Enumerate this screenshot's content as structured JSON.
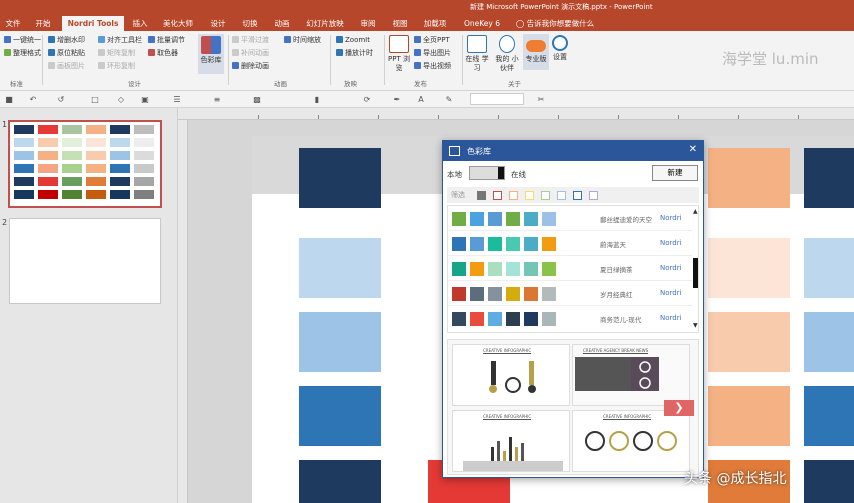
{
  "titlebar": {
    "title": "新建 Microsoft PowerPoint 演示文稿.pptx - PowerPoint"
  },
  "tabs": [
    {
      "label": "文件"
    },
    {
      "label": "开始"
    },
    {
      "label": "Nordri Tools"
    },
    {
      "label": "插入"
    },
    {
      "label": "美化大师"
    },
    {
      "label": "设计"
    },
    {
      "label": "切换"
    },
    {
      "label": "动画"
    },
    {
      "label": "幻灯片放映"
    },
    {
      "label": "审阅"
    },
    {
      "label": "视图"
    },
    {
      "label": "加载项"
    },
    {
      "label": "OneKey 6"
    },
    {
      "label": "告诉我你想要做什么"
    }
  ],
  "ribbon": {
    "col1": [
      "一键统一",
      "整理格式"
    ],
    "col2": [
      "增删水印",
      "原位粘贴",
      "画板图片"
    ],
    "col3": [
      "对齐工具栏",
      "矩阵复制",
      "环形复制"
    ],
    "col4": [
      "批量调节",
      "取色器"
    ],
    "color_lib": "色彩库",
    "anim_col1": [
      "平滑过渡",
      "补间动画",
      "删除动画"
    ],
    "anim_col2": [
      "时间缩放"
    ],
    "zoom_col": [
      "ZoomIt",
      "播放计时"
    ],
    "ppt_browse": "PPT 浏览",
    "publish": [
      "全页PPT",
      "导出图片",
      "导出视频"
    ],
    "online": "在线 学习",
    "partner": "我的 小伙伴",
    "pro": "专业版",
    "settings": "设置",
    "groups": [
      "标准",
      "设计",
      "动画",
      "放映",
      "发布",
      "关于"
    ]
  },
  "watermark": "海学堂 lu.min",
  "thumbs": {
    "slide_numbers": [
      "1",
      "2"
    ]
  },
  "dialog": {
    "title": "色彩库",
    "local_label": "本地",
    "online_label": "在线",
    "new_button": "新建",
    "filter_label": "筛选",
    "palettes": [
      {
        "name": "鄱丝缇迪爱的天空",
        "source": "Nordri",
        "colors": [
          "#70ad47",
          "#4aa3df",
          "#5b9bd5",
          "#70ad47",
          "#4bacc6",
          "#9bc2e6"
        ]
      },
      {
        "name": "蔚海蓝天",
        "source": "Nordri",
        "colors": [
          "#2e75b6",
          "#5b9bd5",
          "#1abc9c",
          "#48c9b0",
          "#4bacc6",
          "#f39c12"
        ]
      },
      {
        "name": "夏日绿摘茶",
        "source": "Nordri",
        "colors": [
          "#17a589",
          "#f39c12",
          "#a9dfbf",
          "#a3e4d7",
          "#73c6b6",
          "#8bc34a"
        ]
      },
      {
        "name": "岁月经典红",
        "source": "Nordri",
        "colors": [
          "#c0392b",
          "#5d6d7e",
          "#85929e",
          "#d4ac0d",
          "#dc7633",
          "#b2babb"
        ]
      },
      {
        "name": "商务范儿-现代",
        "source": "Nordri",
        "colors": [
          "#34495e",
          "#e74c3c",
          "#5dade2",
          "#2c3e50",
          "#1f3a5f",
          "#aab7b8"
        ]
      }
    ],
    "templates": [
      "CREATIVE INFOGRAPHIC",
      "CREATIVE AGENCY BREAK NEWS",
      "CREATIVE INFOGRAPHIC",
      "CREATIVE INFOGRAPHIC"
    ]
  },
  "footer": "头条 @成长指北",
  "colors": {
    "accent": "#b7472a",
    "dialog": "#2b579a"
  }
}
